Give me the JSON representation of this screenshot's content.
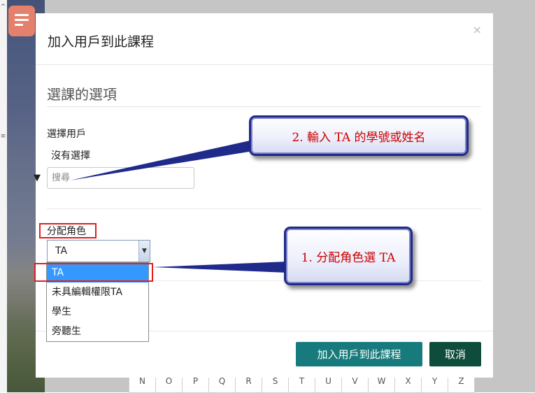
{
  "modal": {
    "title": "加入用戶到此課程",
    "close_symbol": "×",
    "section_title": "選課的選項",
    "select_user_label": "選擇用戶",
    "no_selection_text": "沒有選擇",
    "search_placeholder": "搜尋",
    "assign_role_label": "分配角色",
    "role_selected": "TA",
    "role_options": [
      "TA",
      "未具編輯權限TA",
      "學生",
      "旁聽生"
    ],
    "add_button": "加入用戶到此課程",
    "cancel_button": "取消"
  },
  "annotations": {
    "callout_enter_ta": "2. 輸入 TA 的學號或姓名",
    "callout_assign_role": "1. 分配角色選 TA",
    "callout_color": "#cc0000",
    "highlight_color": "#e21f1f"
  },
  "background": {
    "pager_letters": [
      "N",
      "O",
      "P",
      "Q",
      "R",
      "S",
      "T",
      "U",
      "V",
      "W",
      "X",
      "Y",
      "Z"
    ],
    "menu_button_color": "#e5806c",
    "menu_icon": "hamburger-icon",
    "scroll_up_icon": "chevron-up-icon"
  },
  "colors": {
    "primary_button": "#177a7c",
    "cancel_button": "#0e4d3b",
    "dropdown_selected": "#3399ff"
  }
}
